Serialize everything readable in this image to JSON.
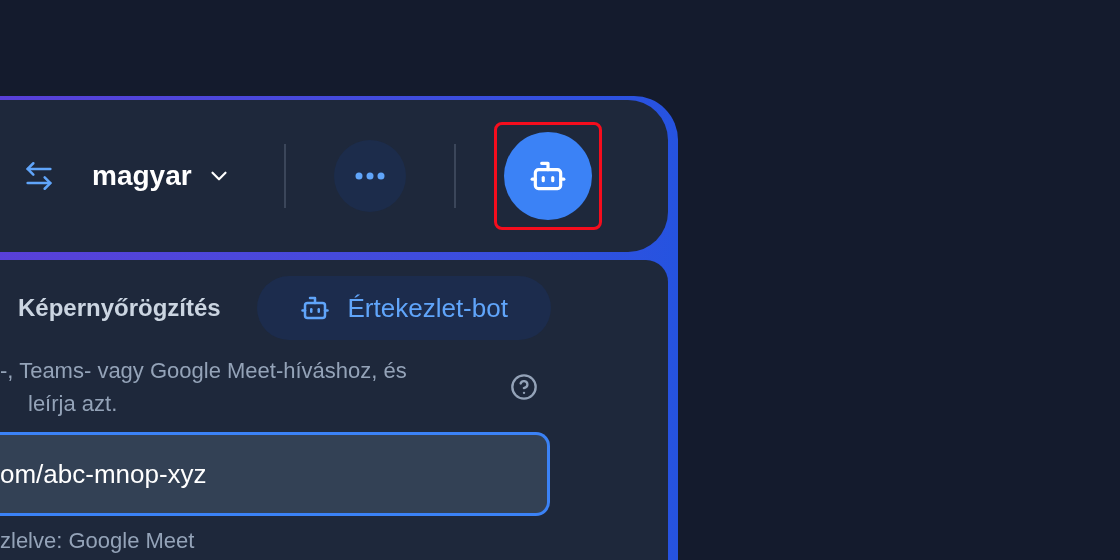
{
  "toolbar": {
    "language": "magyar",
    "bot_button": {
      "highlighted": true
    }
  },
  "mode": {
    "label": "Képernyőrögzítés",
    "bot_tab": {
      "label": "Értekezlet-bot",
      "selected": true
    }
  },
  "description_lines": [
    "-, Teams- vagy Google Meet-híváshoz, és",
    "leírja azt."
  ],
  "meeting_link": {
    "value": "om/abc-mnop-xyz",
    "hint": "zlelve: Google Meet"
  }
}
